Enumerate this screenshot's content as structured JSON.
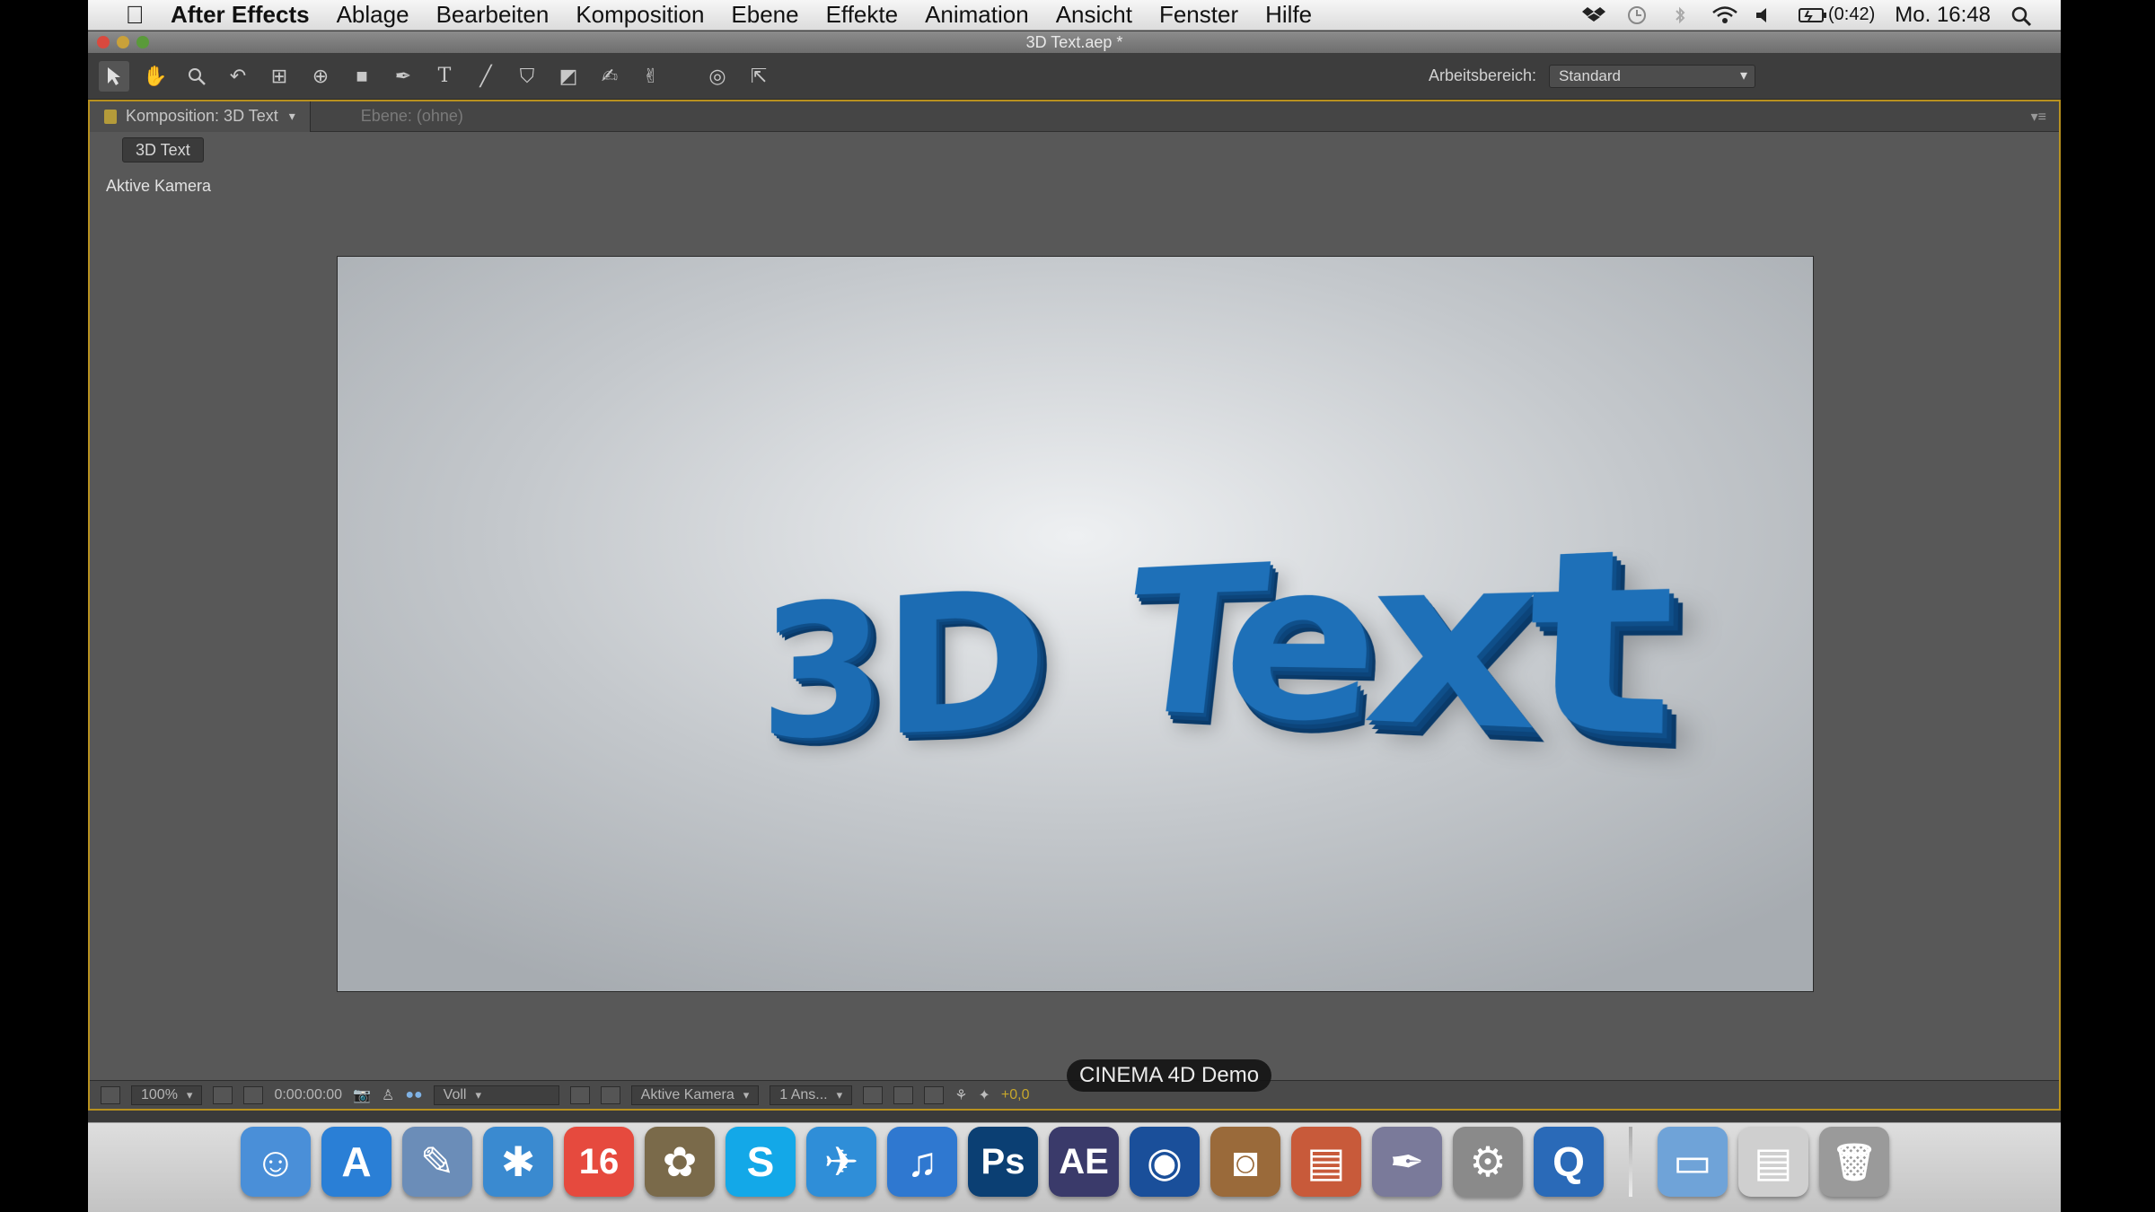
{
  "menubar": {
    "app_name": "After Effects",
    "items": [
      "Ablage",
      "Bearbeiten",
      "Komposition",
      "Ebene",
      "Effekte",
      "Animation",
      "Ansicht",
      "Fenster",
      "Hilfe"
    ],
    "battery": "(0:42)",
    "clock": "Mo. 16:48"
  },
  "window": {
    "title": "3D Text.aep *"
  },
  "toolbar": {
    "workspace_label": "Arbeitsbereich:",
    "workspace_value": "Standard"
  },
  "panel": {
    "tab_active": "Komposition: 3D Text",
    "tab_inactive": "Ebene: (ohne)",
    "comp_crumb": "3D Text",
    "view_label": "Aktive Kamera"
  },
  "viewer": {
    "text_part1": "3D",
    "text_part2": "Text"
  },
  "viewer_footer": {
    "zoom": "100%",
    "timecode": "0:00:00:00",
    "resolution": "Voll",
    "camera": "Aktive Kamera",
    "view_layout": "1 Ans...",
    "exposure": "+0,0"
  },
  "tooltip": "CINEMA 4D Demo",
  "dock": {
    "icons": [
      {
        "name": "finder-icon",
        "color": "#4a8fd8",
        "glyph": "☺"
      },
      {
        "name": "app-store-icon",
        "color": "#2a7fd6",
        "glyph": "A"
      },
      {
        "name": "preview-icon",
        "color": "#6b8db8",
        "glyph": "✎"
      },
      {
        "name": "safari-icon",
        "color": "#3a8ad0",
        "glyph": "✱"
      },
      {
        "name": "calendar-icon",
        "color": "#e64a3e",
        "glyph": "16"
      },
      {
        "name": "iphoto-icon",
        "color": "#7a6a4a",
        "glyph": "✿"
      },
      {
        "name": "skype-icon",
        "color": "#13a8e8",
        "glyph": "S"
      },
      {
        "name": "twitter-icon",
        "color": "#2f8ed8",
        "glyph": "✈"
      },
      {
        "name": "itunes-icon",
        "color": "#2f78d0",
        "glyph": "♫"
      },
      {
        "name": "photoshop-icon",
        "color": "#0b3f73",
        "glyph": "Ps"
      },
      {
        "name": "after-effects-icon",
        "color": "#3a3a6a",
        "glyph": "AE"
      },
      {
        "name": "cinema4d-icon",
        "color": "#1a4f9a",
        "glyph": "◉"
      },
      {
        "name": "iphoto-camera-icon",
        "color": "#9a6a3a",
        "glyph": "◙"
      },
      {
        "name": "keynote-icon",
        "color": "#c85a3a",
        "glyph": "▤"
      },
      {
        "name": "script-editor-icon",
        "color": "#7a7a9a",
        "glyph": "✒"
      },
      {
        "name": "system-preferences-icon",
        "color": "#8a8a8a",
        "glyph": "⚙"
      },
      {
        "name": "quicktime-icon",
        "color": "#2a6ab8",
        "glyph": "Q"
      }
    ],
    "stack_icons": [
      {
        "name": "applications-folder-icon",
        "color": "#6fa3d8",
        "glyph": "▭"
      },
      {
        "name": "documents-stack-icon",
        "color": "#cfcfcf",
        "glyph": "▤"
      },
      {
        "name": "trash-icon",
        "color": "#9a9a9a",
        "glyph": "🗑"
      }
    ]
  }
}
